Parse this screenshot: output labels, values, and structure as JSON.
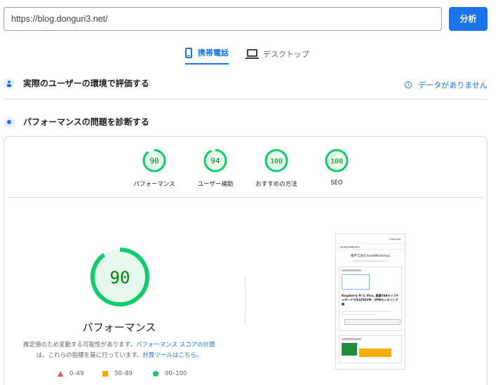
{
  "url_input": {
    "value": "https://blog.donguri3.net/"
  },
  "analyze_button": {
    "label": "分析"
  },
  "tabs": [
    {
      "label": "携帯電話",
      "icon": "phone-icon",
      "active": true
    },
    {
      "label": "デスクトップ",
      "icon": "monitor-icon",
      "active": false
    }
  ],
  "field_section": {
    "title": "実際のユーザーの環境で評価する",
    "icon": "users-icon",
    "no_data": "データがありません",
    "no_data_icon": "info-icon"
  },
  "diagnose_section": {
    "title": "パフォーマンスの問題を診断する",
    "icon": "lab-icon"
  },
  "scores": [
    {
      "value": "90",
      "label": "パフォーマンス"
    },
    {
      "value": "94",
      "label": "ユーザー補助"
    },
    {
      "value": "100",
      "label": "おすすめの方法"
    },
    {
      "value": "100",
      "label": "SEO"
    }
  ],
  "score_fraction": [
    0.9,
    0.94,
    1.0,
    1.0
  ],
  "performance": {
    "score": "90",
    "fraction": 0.9,
    "title": "パフォーマンス",
    "desc_part1": "推定値のため変動する可能性があります。",
    "desc_link1": "パフォーマンス スコアの計算",
    "desc_part2": "は、これらの指標を基に行っています。",
    "desc_link2": "計算ツールはこちら。"
  },
  "legend": [
    {
      "range": "0–49",
      "shape": "triangle",
      "color": "#ff4e42"
    },
    {
      "range": "50–89",
      "shape": "square",
      "color": "#ffa400"
    },
    {
      "range": "90–100",
      "shape": "circle",
      "color": "#0cce6b"
    }
  ],
  "colors": {
    "accent": "#1a73e8",
    "good": "#0cce6b",
    "good_text": "#008800",
    "good_bg": "#e6f8ee"
  },
  "thumbnail": {
    "site_title": "秘芦工房/ClosetWorkshop",
    "headline": "Raspberry Pi 3, Pico, 貴重USBキャプチャボードで作るPiKVM - VPNモニタリング編"
  }
}
